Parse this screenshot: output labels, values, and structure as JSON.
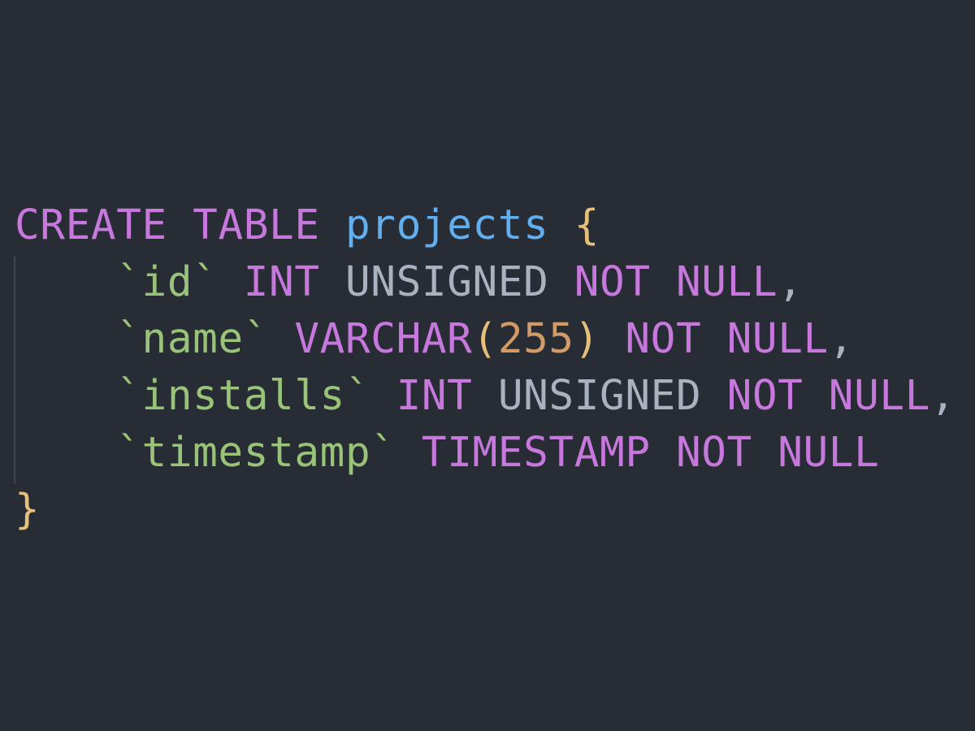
{
  "code": {
    "line1": {
      "create": "CREATE",
      "table": "TABLE",
      "name": "projects",
      "open_brace": "{"
    },
    "line2": {
      "column": "`id`",
      "type": "INT",
      "modifier": "UNSIGNED",
      "not": "NOT",
      "null": "NULL",
      "comma": ","
    },
    "line3": {
      "column": "`name`",
      "type": "VARCHAR",
      "open_paren": "(",
      "length": "255",
      "close_paren": ")",
      "not": "NOT",
      "null": "NULL",
      "comma": ","
    },
    "line4": {
      "column": "`installs`",
      "type": "INT",
      "modifier": "UNSIGNED",
      "not": "NOT",
      "null": "NULL",
      "comma": ","
    },
    "line5": {
      "column": "`timestamp`",
      "type": "TIMESTAMP",
      "not": "NOT",
      "null": "NULL"
    },
    "line6": {
      "close_brace": "}"
    }
  },
  "colors": {
    "background": "#282c34",
    "keyword": "#c678dd",
    "identifier": "#61afef",
    "brace": "#e5c07b",
    "string": "#98c379",
    "plain": "#abb2bf",
    "number": "#d19a66"
  }
}
